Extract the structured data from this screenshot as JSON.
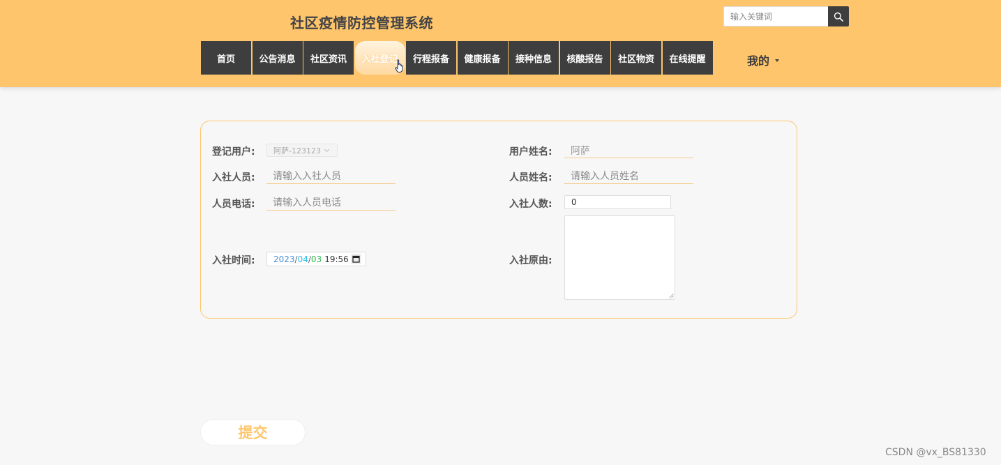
{
  "header": {
    "title": "社区疫情防控管理系统",
    "search_placeholder": "输入关键词"
  },
  "nav": {
    "items": [
      {
        "label": "首页"
      },
      {
        "label": "公告消息"
      },
      {
        "label": "社区资讯"
      },
      {
        "label": "入社登记",
        "active": true
      },
      {
        "label": "行程报备"
      },
      {
        "label": "健康报备"
      },
      {
        "label": "接种信息"
      },
      {
        "label": "核酸报告"
      },
      {
        "label": "社区物资"
      },
      {
        "label": "在线提醒"
      }
    ],
    "my_label": "我的"
  },
  "form": {
    "register_user_label": "登记用户:",
    "register_user_value": "阿萨-123123",
    "user_name_label": "用户姓名:",
    "user_name_value": "阿萨",
    "member_label": "入社人员:",
    "member_placeholder": "请输入入社人员",
    "person_name_label": "人员姓名:",
    "person_name_placeholder": "请输入人员姓名",
    "phone_label": "人员电话:",
    "phone_placeholder": "请输入人员电话",
    "count_label": "入社人数:",
    "count_value": "0",
    "time_label": "入社时间:",
    "time_year": "2023",
    "time_month": "04",
    "time_day": "03",
    "time_clock": "19:56",
    "reason_label": "入社原由:"
  },
  "submit_label": "提交",
  "watermark": "CSDN @vx_BS81330",
  "colors": {
    "header_bg": "#fec56c",
    "nav_bg": "#3e3e3e",
    "accent": "#fec56c",
    "page_bg": "#f7f7f7"
  }
}
